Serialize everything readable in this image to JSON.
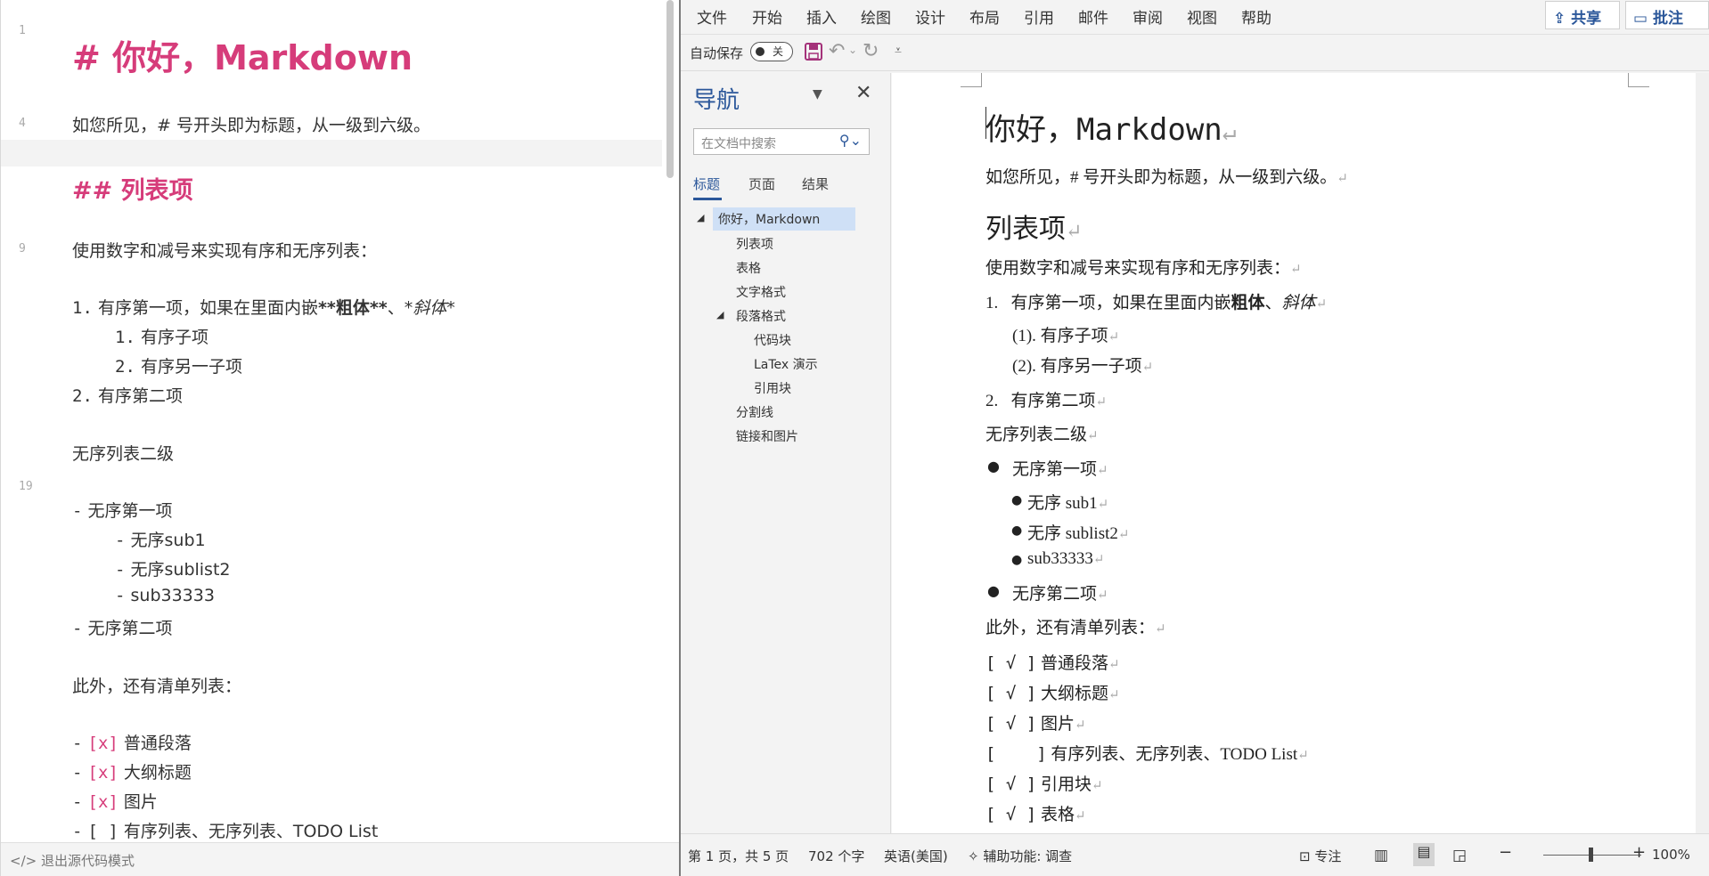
{
  "editor": {
    "line_numbers": [
      "1",
      "4",
      "9",
      "19"
    ],
    "h1": "# 你好，Markdown",
    "intro": "如您所见，# 号开头即为标题，从一级到六级。",
    "h2": "## 列表项",
    "list_intro": "使用数字和减号来实现有序和无序列表：",
    "ol1_num": "1.",
    "ol1_text": "有序第一项，如果在里面内嵌",
    "ol1_bold": "**粗体**",
    "ol1_sep": "、",
    "ol1_italic": "*斜体*",
    "ol1_sub1_num": "1.",
    "ol1_sub1_text": "有序子项",
    "ol1_sub2_num": "2.",
    "ol1_sub2_text": "有序另一子项",
    "ol2_num": "2.",
    "ol2_text": "有序第二项",
    "ul_label": "无序列表二级",
    "dash": "-",
    "ul1": "无序第一项",
    "ul1_sub1": "无序sub1",
    "ul1_sub2": "无序sublist2",
    "ul1_sub3": "sub33333",
    "ul2": "无序第二项",
    "todo_intro": "此外，还有清单列表：",
    "todos": [
      {
        "mark": "[x]",
        "text": "普通段落"
      },
      {
        "mark": "[x]",
        "text": "大纲标题"
      },
      {
        "mark": "[x]",
        "text": "图片"
      },
      {
        "mark": "[ ]",
        "text": "有序列表、无序列表、TODO List"
      }
    ],
    "status_exit_icon": "</>",
    "status_exit": "退出源代码模式"
  },
  "word": {
    "tabs": [
      "文件",
      "开始",
      "插入",
      "绘图",
      "设计",
      "布局",
      "引用",
      "邮件",
      "审阅",
      "视图",
      "帮助"
    ],
    "share": "共享",
    "comment": "批注",
    "autosave_label": "自动保存",
    "autosave_state": "关",
    "nav": {
      "title": "导航",
      "search_placeholder": "在文档中搜索",
      "tabs": [
        "标题",
        "页面",
        "结果"
      ],
      "items": [
        "你好，Markdown",
        "列表项",
        "表格",
        "文字格式",
        "段落格式",
        "代码块",
        "LaTex 演示",
        "引用块",
        "分割线",
        "链接和图片"
      ]
    },
    "doc": {
      "title": "你好，Markdown",
      "intro": "如您所见，# 号开头即为标题，从一级到六级。",
      "h2": "列表项",
      "list_intro": "使用数字和减号来实现有序和无序列表：",
      "ol1_num": "1.",
      "ol1_text": "有序第一项，如果在里面内嵌",
      "ol1_bold": "粗体",
      "ol1_sep": "、",
      "ol1_italic": "斜体",
      "ol1_sub1": "(1). 有序子项",
      "ol1_sub2": "(2). 有序另一子项",
      "ol2_num": "2.",
      "ol2_text": "有序第二项",
      "ul_label": "无序列表二级",
      "ul1": "无序第一项",
      "ul1_sub1": "无序 sub1",
      "ul1_sub2": "无序 sublist2",
      "ul1_sub3": "sub33333",
      "ul2": "无序第二项",
      "todo_intro": "此外，还有清单列表：",
      "todos": [
        {
          "mark": "[ √ ]",
          "text": "普通段落"
        },
        {
          "mark": "[ √ ]",
          "text": "大纲标题"
        },
        {
          "mark": "[ √ ]",
          "text": "图片"
        },
        {
          "mark": "[    ]",
          "text": "有序列表、无序列表、TODO List"
        },
        {
          "mark": "[ √ ]",
          "text": "引用块"
        },
        {
          "mark": "[ √ ]",
          "text": "表格"
        }
      ],
      "para_mark": "↵"
    },
    "status": {
      "page": "第 1 页，共 5 页",
      "words": "702 个字",
      "lang": "英语(美国)",
      "accessibility": "辅助功能: 调查",
      "focus": "专注",
      "zoom_minus": "−",
      "zoom_plus": "+",
      "zoom": "100%"
    }
  },
  "colors": {
    "heading_pink": "#d63c7a",
    "word_blue": "#2b579a"
  },
  "icons": [
    "code-icon",
    "save-icon",
    "undo-icon",
    "redo-icon",
    "customize-qat-icon",
    "search-icon",
    "close-icon",
    "share-icon",
    "comment-icon",
    "accessibility-icon",
    "focus-icon",
    "read-mode-icon",
    "print-layout-icon",
    "web-layout-icon"
  ]
}
